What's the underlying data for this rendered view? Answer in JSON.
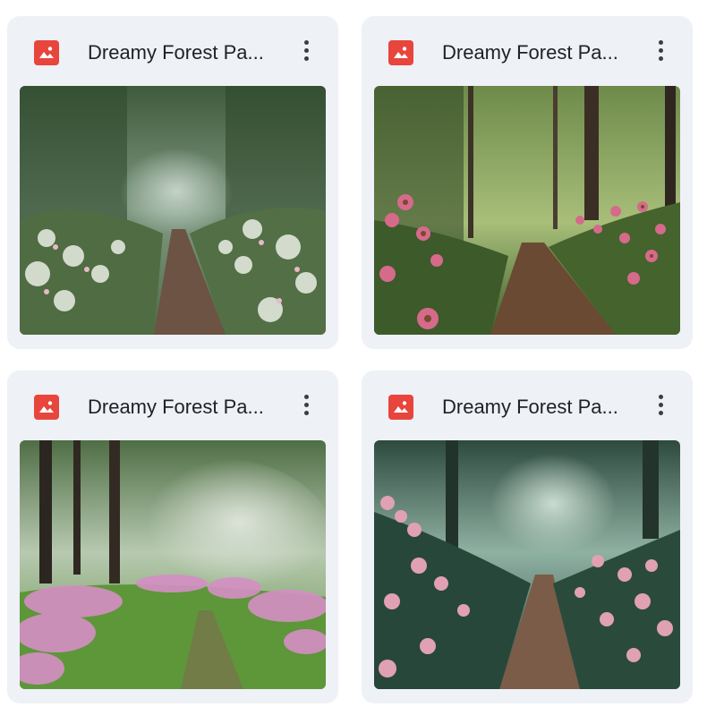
{
  "files": [
    {
      "name": "Dreamy Forest Pa...",
      "icon": "image-file-icon",
      "menu_icon": "more-vert-icon",
      "thumbnail_alt": "misty forest path with white and pink flowers"
    },
    {
      "name": "Dreamy Forest Pa...",
      "icon": "image-file-icon",
      "menu_icon": "more-vert-icon",
      "thumbnail_alt": "forest path with pink coneflowers"
    },
    {
      "name": "Dreamy Forest Pa...",
      "icon": "image-file-icon",
      "menu_icon": "more-vert-icon",
      "thumbnail_alt": "foggy green meadow path with pink wildflowers"
    },
    {
      "name": "Dreamy Forest Pa...",
      "icon": "image-file-icon",
      "menu_icon": "more-vert-icon",
      "thumbnail_alt": "teal misty forest path with pink roses"
    }
  ],
  "colors": {
    "card_background": "#eef1f6",
    "icon_red": "#e8453c",
    "title_text": "#1f2124"
  }
}
